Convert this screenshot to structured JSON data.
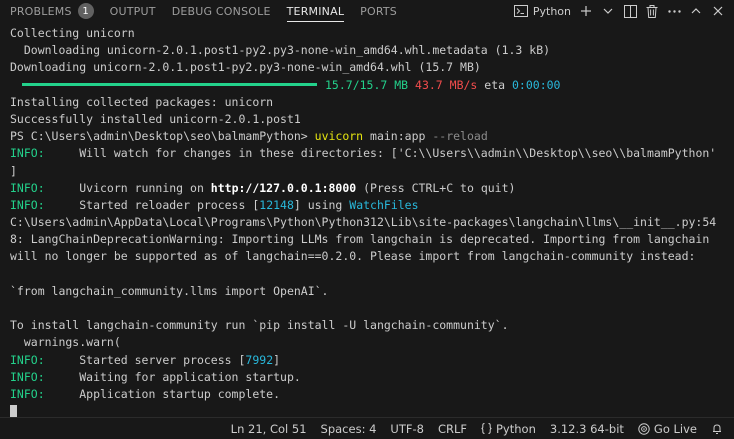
{
  "tabs": [
    {
      "label": "PROBLEMS",
      "badge": "1"
    },
    {
      "label": "OUTPUT"
    },
    {
      "label": "DEBUG CONSOLE"
    },
    {
      "label": "TERMINAL"
    },
    {
      "label": "PORTS"
    }
  ],
  "terminal_profile": "Python",
  "terminal": {
    "l1": "Collecting unicorn",
    "l2": "  Downloading unicorn-2.0.1.post1-py2.py3-none-win_amd64.whl.metadata (1.3 kB)",
    "l3": "Downloading unicorn-2.0.1.post1-py2.py3-none-win_amd64.whl (15.7 MB)",
    "progress": {
      "fraction": 1.0,
      "size": "15.7/15.7 MB",
      "speed": "43.7 MB/s",
      "eta_label": "eta",
      "eta": "0:00:00"
    },
    "l5": "Installing collected packages: unicorn",
    "l6": "Successfully installed unicorn-2.0.1.post1",
    "prompt": "PS C:\\Users\\admin\\Desktop\\seo\\balmamPython> ",
    "cmd": "uvicorn",
    "cmd_args": " main:app ",
    "cmd_flag": "--reload",
    "info_label": "INFO:",
    "watch": "     Will watch for changes in these directories: ['C:\\\\Users\\\\admin\\\\Desktop\\\\seo\\\\balmamPython'",
    "watch_end": "]",
    "running_pre": "     Uvicorn running on ",
    "running_url": "http://127.0.0.1:8000",
    "running_post": " (Press CTRL+C to quit)",
    "reloader_pre": "     Started reloader process [",
    "reloader_pid": "12148",
    "reloader_mid": "] using ",
    "reloader_tool": "WatchFiles",
    "warn1": "C:\\Users\\admin\\AppData\\Local\\Programs\\Python\\Python312\\Lib\\site-packages\\langchain\\llms\\__init__.py:54",
    "warn2": "8: LangChainDeprecationWarning: Importing LLMs from langchain is deprecated. Importing from langchain",
    "warn3": "will no longer be supported as of langchain==0.2.0. Please import from langchain-community instead:",
    "warn4": "`from langchain_community.llms import OpenAI`.",
    "warn5": "To install langchain-community run `pip install -U langchain-community`.",
    "warn6": "  warnings.warn(",
    "server_pre": "     Started server process [",
    "server_pid": "7992",
    "server_post": "]",
    "waiting": "     Waiting for application startup.",
    "complete": "     Application startup complete."
  },
  "status": {
    "position": "Ln 21, Col 51",
    "spaces": "Spaces: 4",
    "encoding": "UTF-8",
    "eol": "CRLF",
    "language": "Python",
    "interpreter": "3.12.3 64-bit",
    "golive": "Go Live"
  },
  "colors": {
    "background": "#181818",
    "info": "#23d18b",
    "link": "#29b8db",
    "command": "#e5e510"
  }
}
